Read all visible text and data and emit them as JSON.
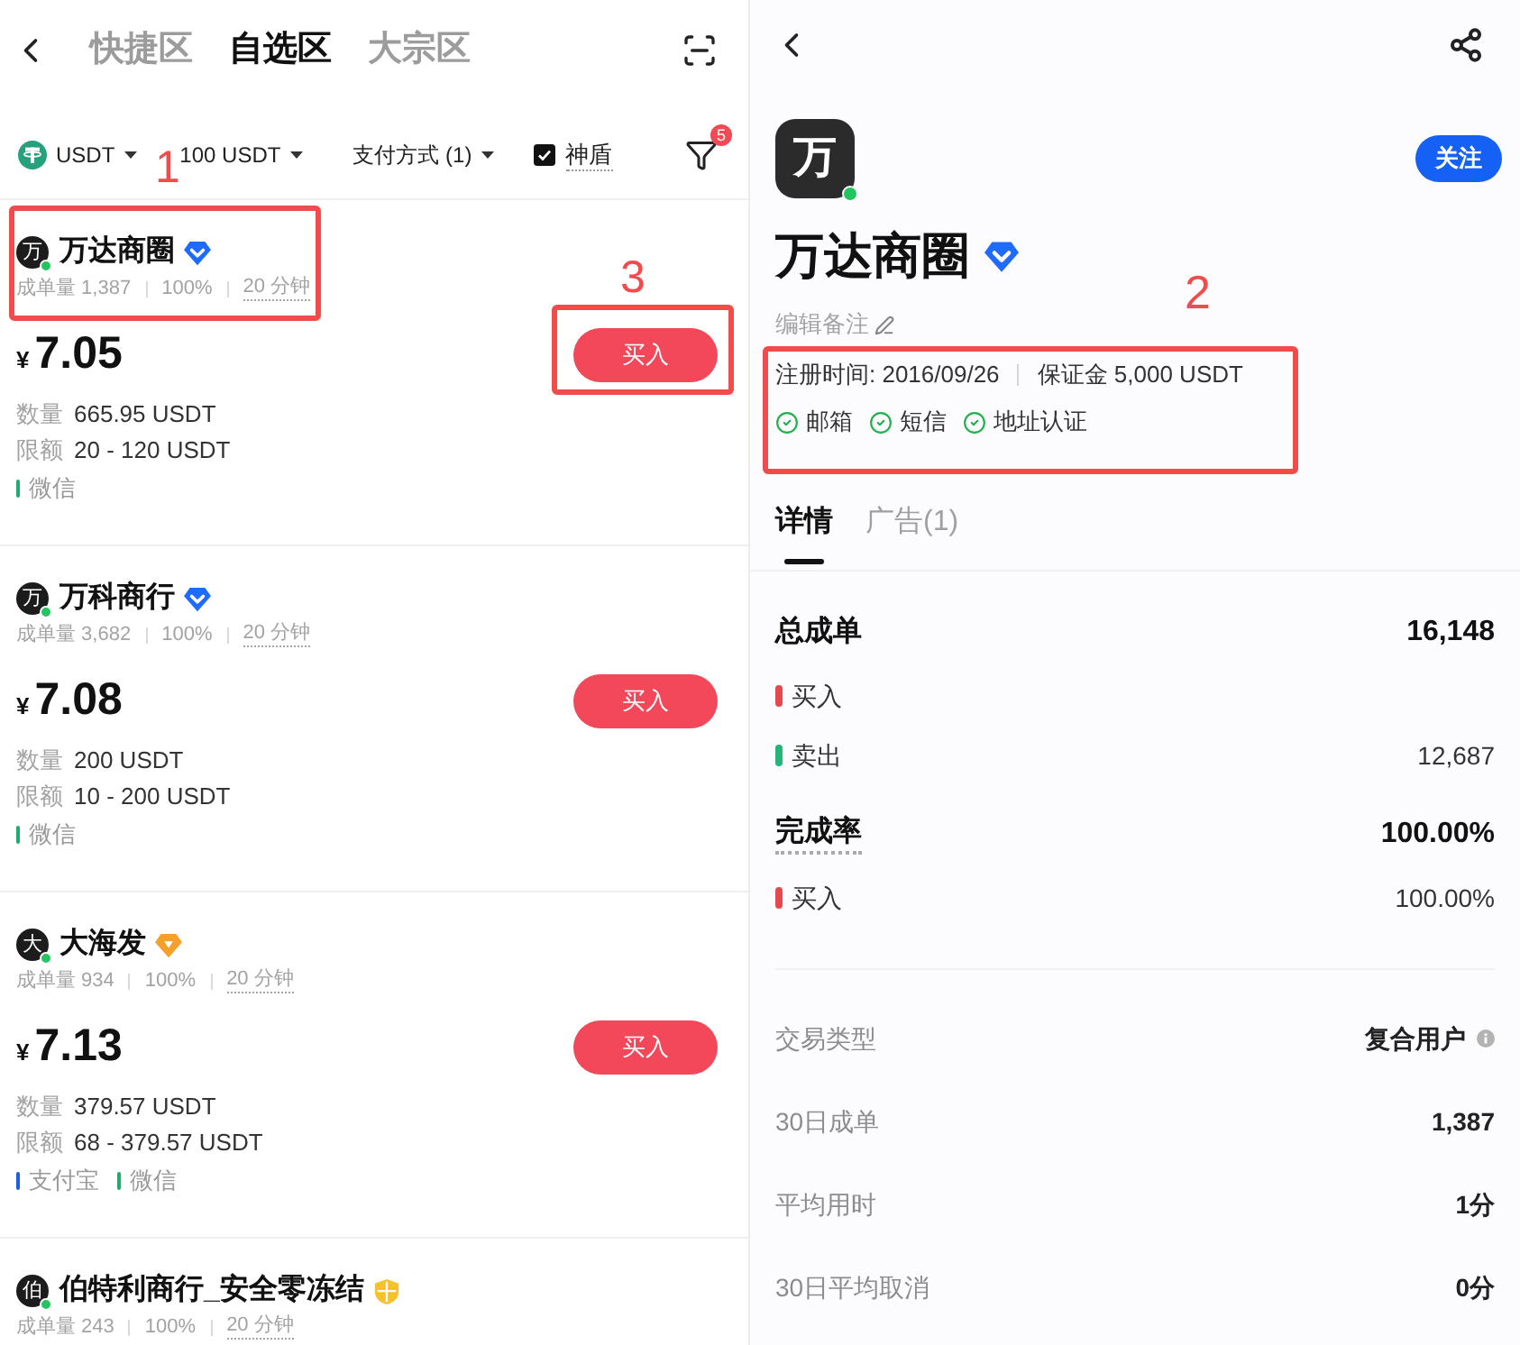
{
  "list_screen": {
    "tabs": [
      {
        "label": "快捷区",
        "selected": false
      },
      {
        "label": "自选区",
        "selected": true
      },
      {
        "label": "大宗区",
        "selected": false
      }
    ],
    "filters": {
      "coin": "USDT",
      "amount": "100 USDT",
      "payment": "支付方式 (1)",
      "shield": {
        "label": "神盾",
        "checked": true
      },
      "filter_count": "5"
    },
    "merchants": [
      {
        "avatar": "万",
        "online": true,
        "name": "万达商圈",
        "badge": {
          "kind": "verified"
        },
        "orders": "成单量 1,387",
        "rate": "100%",
        "time": "20 分钟",
        "currency": "¥",
        "price": "7.05",
        "quantity_label": "数量",
        "quantity": "665.95 USDT",
        "limit_label": "限额",
        "limit": "20 - 120 USDT",
        "payments": [
          {
            "name": "微信",
            "color": "#1faa6e"
          }
        ],
        "action": "买入",
        "header_annotation": "1",
        "action_annotation": "3"
      },
      {
        "avatar": "万",
        "online": true,
        "name": "万科商行",
        "badge": {
          "kind": "verified"
        },
        "orders": "成单量 3,682",
        "rate": "100%",
        "time": "20 分钟",
        "currency": "¥",
        "price": "7.08",
        "quantity_label": "数量",
        "quantity": "200 USDT",
        "limit_label": "限额",
        "limit": "10 - 200 USDT",
        "payments": [
          {
            "name": "微信",
            "color": "#1faa6e"
          }
        ],
        "action": "买入"
      },
      {
        "avatar": "大",
        "online": true,
        "name": "大海发",
        "badge": {
          "kind": "gem"
        },
        "orders": "成单量 934",
        "rate": "100%",
        "time": "20 分钟",
        "currency": "¥",
        "price": "7.13",
        "quantity_label": "数量",
        "quantity": "379.57 USDT",
        "limit_label": "限额",
        "limit": "68 - 379.57 USDT",
        "payments": [
          {
            "name": "支付宝",
            "color": "#1d5fe0"
          },
          {
            "name": "微信",
            "color": "#1faa6e"
          }
        ],
        "action": "买入"
      },
      {
        "avatar": "伯",
        "online": true,
        "name": "伯特利商行_安全零冻结",
        "badge": {
          "kind": "shield"
        },
        "orders": "成单量 243",
        "rate": "100%",
        "time": "20 分钟"
      }
    ]
  },
  "detail_screen": {
    "profile": {
      "avatar": "万",
      "online": true,
      "follow": "关注",
      "name": "万达商圈",
      "badge": {
        "kind": "verified"
      },
      "note": "编辑备注",
      "registered": "注册时间: 2016/09/26",
      "deposit": "保证金 5,000 USDT",
      "verifications": [
        "邮箱",
        "短信",
        "地址认证"
      ],
      "annotation": "2"
    },
    "tabs": [
      {
        "label": "详情",
        "selected": true
      },
      {
        "label": "广告(1)",
        "selected": false
      }
    ],
    "order_stats": [
      {
        "kind": "heading",
        "label": "总成单",
        "value": "16,148",
        "dotted": false
      },
      {
        "kind": "sub",
        "label": "买入",
        "color": "#e5484d",
        "dotted": false
      },
      {
        "kind": "sub",
        "label": "卖出",
        "value": "12,687",
        "color": "#25b37a",
        "dotted": false
      },
      {
        "kind": "heading",
        "label": "完成率",
        "value": "100.00%",
        "dotted": true
      },
      {
        "kind": "sub",
        "label": "买入",
        "value": "100.00%",
        "color": "#e5484d",
        "dotted": false
      }
    ],
    "details": [
      {
        "label": "交易类型",
        "value": "复合用户",
        "info": true
      },
      {
        "label": "30日成单",
        "value": "1,387",
        "info": false
      },
      {
        "label": "平均用时",
        "value": "1分",
        "info": false
      },
      {
        "label": "30日平均取消",
        "value": "0分",
        "info": false
      }
    ]
  }
}
